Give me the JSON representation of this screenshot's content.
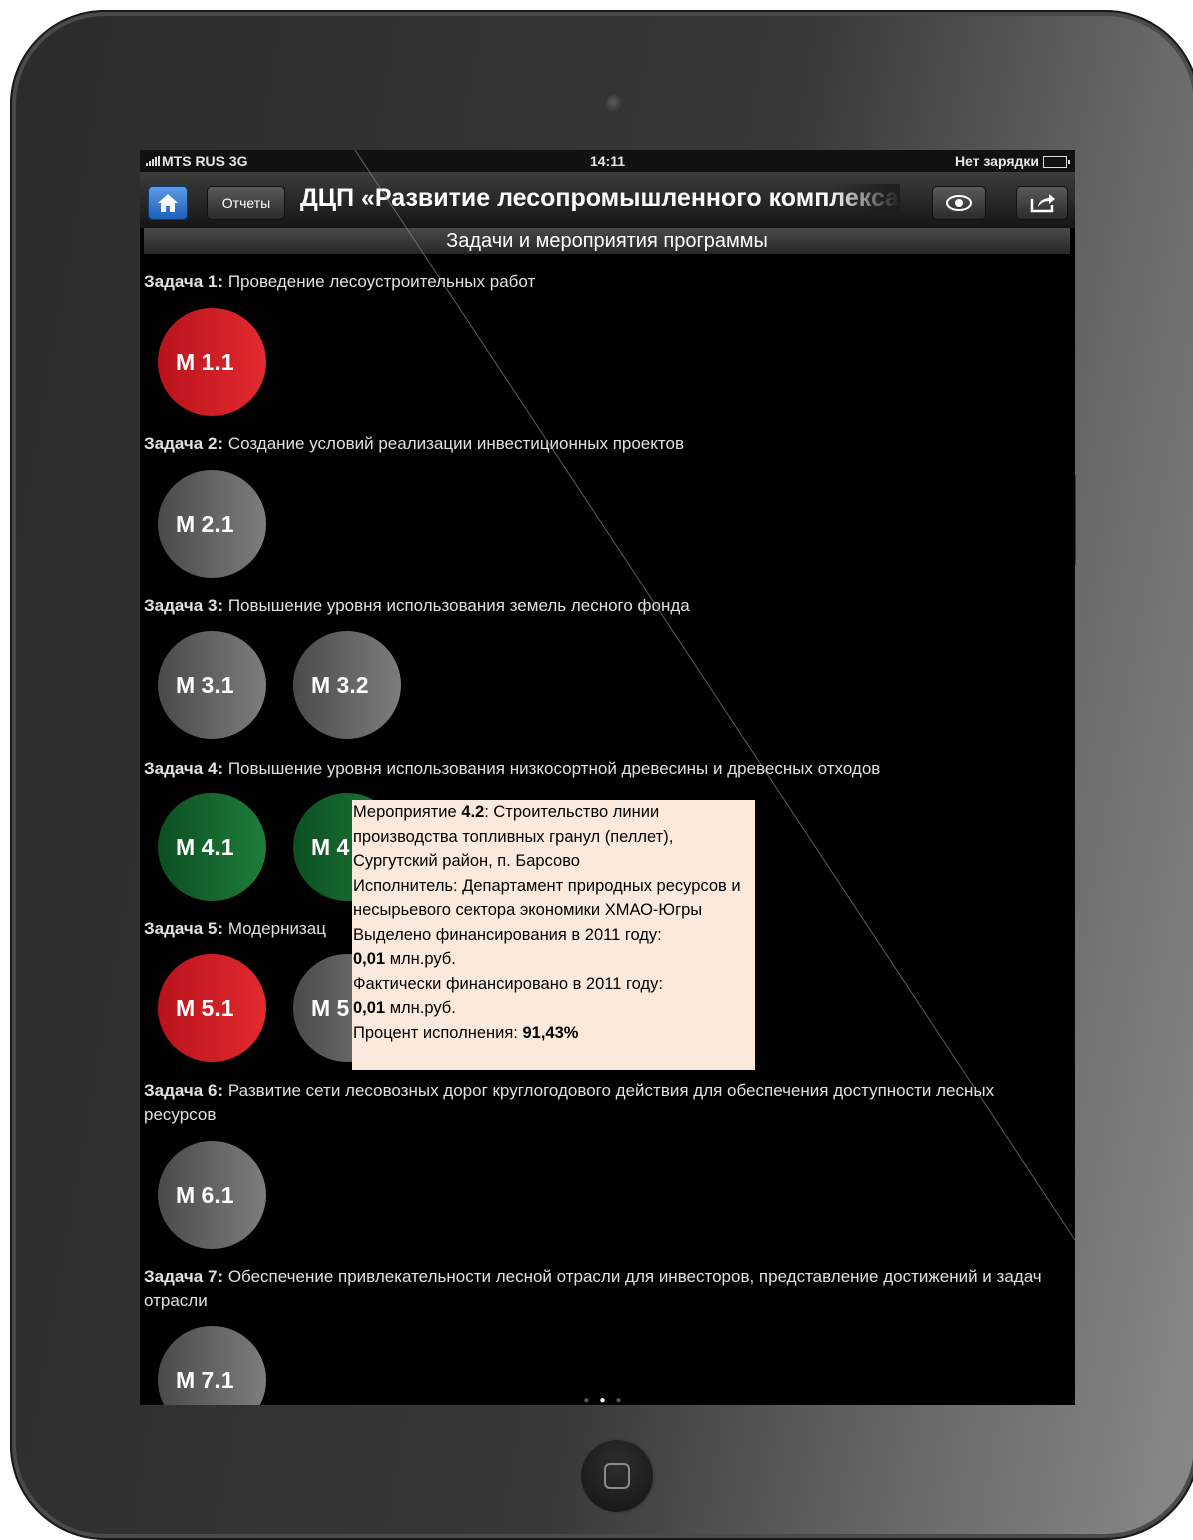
{
  "status_bar": {
    "carrier": "MTS RUS  3G",
    "time": "14:11",
    "battery_text": "Нет зарядки"
  },
  "nav": {
    "reports_label": "Отчеты",
    "title": "ДЦП «Развитие лесопромышленного комплекса»"
  },
  "subheader": "Задачи и мероприятия программы",
  "tasks": [
    {
      "label": "Задача 1:",
      "text": "Проведение лесоустроительных работ"
    },
    {
      "label": "Задача 2:",
      "text": "Создание условий реализации инвестиционных проектов"
    },
    {
      "label": "Задача 3:",
      "text": "Повышение уровня использования земель лесного фонда"
    },
    {
      "label": "Задача 4:",
      "text": "Повышение уровня использования низкосортной древесины и древесных отходов"
    },
    {
      "label": "Задача 5:",
      "text": "Модернизац"
    },
    {
      "label": "Задача 6:",
      "text": "Развитие сети лесовозных дорог круглогодового действия для обеспечения доступности лесных ресурсов"
    },
    {
      "label": "Задача 7:",
      "text": "Обеспечение привлекательности лесной отрасли для инвесторов, представление достижений и задач отрасли"
    }
  ],
  "measures": {
    "m11": "М 1.1",
    "m21": "М 2.1",
    "m31": "М 3.1",
    "m32": "М 3.2",
    "m41": "М 4.1",
    "m42": "М 4",
    "m51": "М 5.1",
    "m52": "М 5",
    "m61": "М 6.1",
    "m71": "М 7.1"
  },
  "tooltip": {
    "title_prefix": "Мероприятие ",
    "title_num": "4.2",
    "title_rest": ": Строительство линии производства топливных гранул (пеллет), Сургутский район, п. Барсово",
    "executor": "Исполнитель: Департамент природных ресурсов и несырьевого сектора экономики ХМАО-Югры",
    "allocated_label": "Выделено финансирования в 2011 году:",
    "allocated_value": "0,01",
    "allocated_unit": " млн.руб.",
    "actual_label": "Фактически финансировано в 2011 году:",
    "actual_value": "0,01",
    "actual_unit": " млн.руб.",
    "percent_label": "Процент исполнения: ",
    "percent_value": "91,43%"
  },
  "side_tab": "7",
  "colors": {
    "status_red": "#e32a2f",
    "status_grey": "#7d7d7d",
    "status_green": "#1e7d3a",
    "tooltip_bg": "#fbeadc",
    "home_button_blue": "#1e5fb8"
  },
  "icons": [
    "home-icon",
    "eye-icon",
    "share-icon",
    "comment-icon",
    "battery-icon",
    "signal-icon"
  ],
  "page_indicator": {
    "pages": 3,
    "current": 2
  }
}
